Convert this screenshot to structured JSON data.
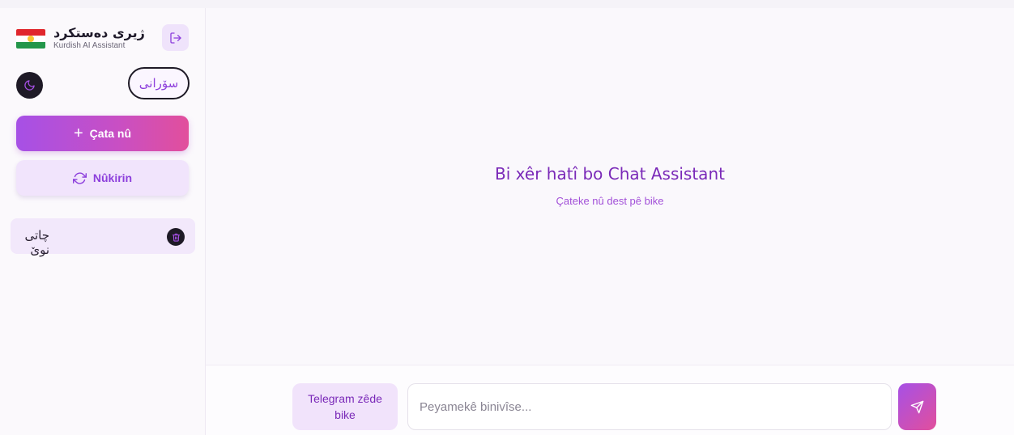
{
  "brand": {
    "title": "ژیری دەستکرد",
    "subtitle": "Kurdish AI Assistant",
    "flag_colors": {
      "red": "#e0262c",
      "white": "#ffffff",
      "green": "#23964a",
      "sun": "#f7c531"
    }
  },
  "sidebar": {
    "logout_icon": "logout-icon",
    "theme_icon": "moon-icon",
    "language_label": "سۆرانی",
    "new_chat_label": "Çata nû",
    "refresh_label": "Nûkirin",
    "chats": [
      {
        "title": "چاتی نوێ",
        "delete_icon": "trash-icon"
      }
    ]
  },
  "main": {
    "welcome_title": "Bi xêr hatî bo Chat Assistant",
    "welcome_subtitle": "Çateke nû dest pê bike"
  },
  "composer": {
    "telegram_label": "Telegram zêde bike",
    "input_placeholder": "Peyamekê binivîse...",
    "input_value": "",
    "send_icon": "send-icon"
  },
  "colors": {
    "accent": "#a650e6",
    "accent_pink": "#e24f9c",
    "accent_text": "#7a29b8"
  }
}
